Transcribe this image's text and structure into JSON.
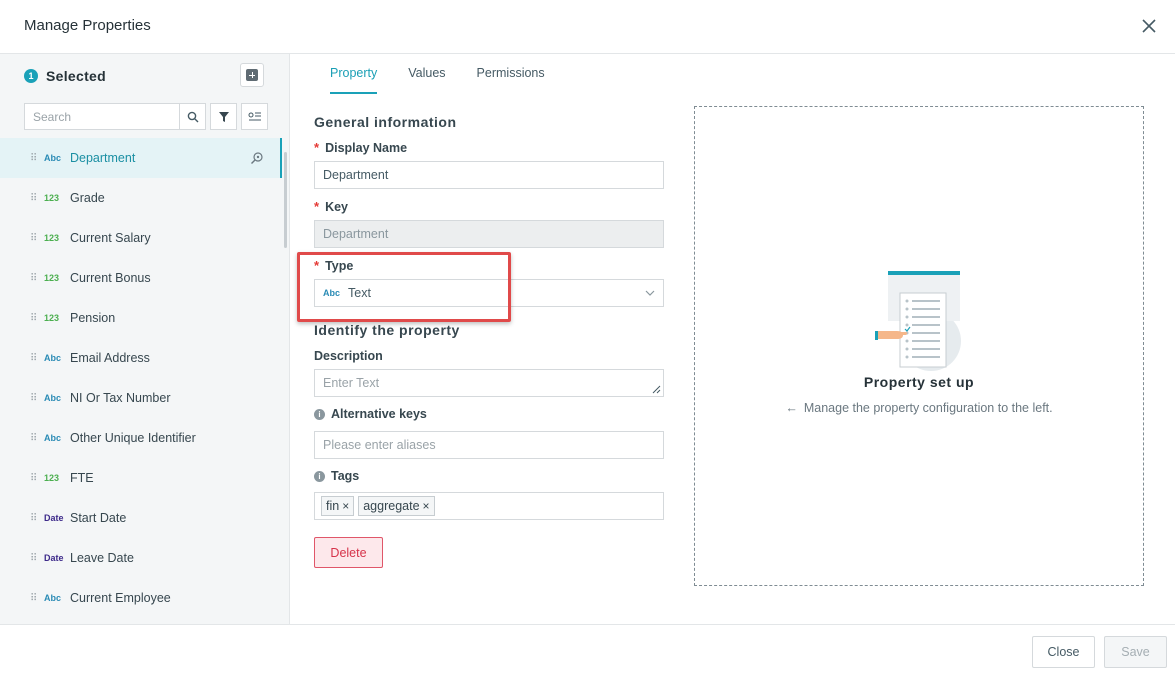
{
  "header": {
    "title": "Manage Properties"
  },
  "sidebar": {
    "selected_count": "1",
    "selected_label": "Selected",
    "search_placeholder": "Search",
    "items": [
      {
        "type": "Abc",
        "name": "Department"
      },
      {
        "type": "123",
        "name": "Grade"
      },
      {
        "type": "123",
        "name": "Current Salary"
      },
      {
        "type": "123",
        "name": "Current Bonus"
      },
      {
        "type": "123",
        "name": "Pension"
      },
      {
        "type": "Abc",
        "name": "Email Address"
      },
      {
        "type": "Abc",
        "name": "NI Or Tax Number"
      },
      {
        "type": "Abc",
        "name": "Other Unique Identifier"
      },
      {
        "type": "123",
        "name": "FTE"
      },
      {
        "type": "Date",
        "name": "Start Date"
      },
      {
        "type": "Date",
        "name": "Leave Date"
      },
      {
        "type": "Abc",
        "name": "Current Employee"
      }
    ]
  },
  "tabs": [
    "Property",
    "Values",
    "Permissions"
  ],
  "form": {
    "general_title": "General information",
    "display_name_label": "Display Name",
    "display_name_value": "Department",
    "key_label": "Key",
    "key_value": "Department",
    "type_label": "Type",
    "type_tag": "Abc",
    "type_value": "Text",
    "identify_title": "Identify the property",
    "description_label": "Description",
    "description_placeholder": "Enter Text",
    "alt_keys_label": "Alternative keys",
    "alt_keys_placeholder": "Please enter aliases",
    "tags_label": "Tags",
    "tags": [
      "fin",
      "aggregate"
    ],
    "delete_label": "Delete"
  },
  "placeholder": {
    "title": "Property set up",
    "subtitle": "Manage the property configuration to the left."
  },
  "footer": {
    "close_label": "Close",
    "save_label": "Save"
  },
  "colors": {
    "accent": "#1aa1b8",
    "danger": "#d6334a",
    "highlight": "#e04a4a"
  }
}
